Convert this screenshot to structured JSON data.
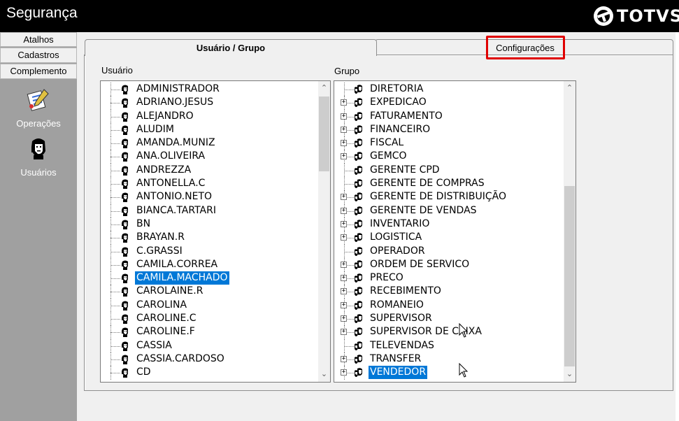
{
  "window": {
    "title": "Segurança"
  },
  "brand": {
    "logo_text": "TOTVS"
  },
  "sidebar": {
    "tabs": [
      {
        "label": "Atalhos"
      },
      {
        "label": "Cadastros"
      },
      {
        "label": "Complemento"
      }
    ],
    "items": [
      {
        "label": "Operações",
        "icon": "operations-icon"
      },
      {
        "label": "Usuários",
        "icon": "user-icon"
      }
    ]
  },
  "tabs": {
    "active": "Usuário  / Grupo",
    "inactive": "Configurações"
  },
  "usuarios": {
    "label": "Usuário",
    "items": [
      "ADMINISTRADOR",
      "ADRIANO.JESUS",
      "ALEJANDRO",
      "ALUDIM",
      "AMANDA.MUNIZ",
      "ANA.OLIVEIRA",
      "ANDREZZA",
      "ANTONELLA.C",
      "ANTONIO.NETO",
      "BIANCA.TARTARI",
      "BN",
      "BRAYAN.R",
      "C.GRASSI",
      "CAMILA.CORREA",
      "CAMILA.MACHADO",
      "CAROLAINE.R",
      "CAROLINA",
      "CAROLINE.C",
      "CAROLINE.F",
      "CASSIA",
      "CASSIA.CARDOSO",
      "CD"
    ],
    "selected_index": 14
  },
  "grupos": {
    "label": "Grupo",
    "items": [
      {
        "name": "DIRETORIA",
        "expandable": false
      },
      {
        "name": "EXPEDICAO",
        "expandable": true
      },
      {
        "name": "FATURAMENTO",
        "expandable": true
      },
      {
        "name": "FINANCEIRO",
        "expandable": true
      },
      {
        "name": "FISCAL",
        "expandable": true
      },
      {
        "name": "GEMCO",
        "expandable": true
      },
      {
        "name": "GERENTE CPD",
        "expandable": false
      },
      {
        "name": "GERENTE DE COMPRAS",
        "expandable": false
      },
      {
        "name": "GERENTE DE DISTRIBUIÇÃO",
        "expandable": true
      },
      {
        "name": "GERENTE DE VENDAS",
        "expandable": true
      },
      {
        "name": "INVENTARIO",
        "expandable": true
      },
      {
        "name": "LOGISTICA",
        "expandable": true
      },
      {
        "name": "OPERADOR",
        "expandable": false
      },
      {
        "name": "ORDEM DE SERVICO",
        "expandable": true
      },
      {
        "name": "PRECO",
        "expandable": true
      },
      {
        "name": "RECEBIMENTO",
        "expandable": true
      },
      {
        "name": "ROMANEIO",
        "expandable": true
      },
      {
        "name": "SUPERVISOR",
        "expandable": true
      },
      {
        "name": "SUPERVISOR DE CAIXA",
        "expandable": true
      },
      {
        "name": "TELEVENDAS",
        "expandable": false
      },
      {
        "name": "TRANSFER",
        "expandable": true
      },
      {
        "name": "VENDEDOR",
        "expandable": true
      }
    ],
    "selected_index": 21
  },
  "colors": {
    "selection": "#0078d7",
    "highlight_box": "#e00000",
    "sidebar": "#a0a0a0"
  }
}
